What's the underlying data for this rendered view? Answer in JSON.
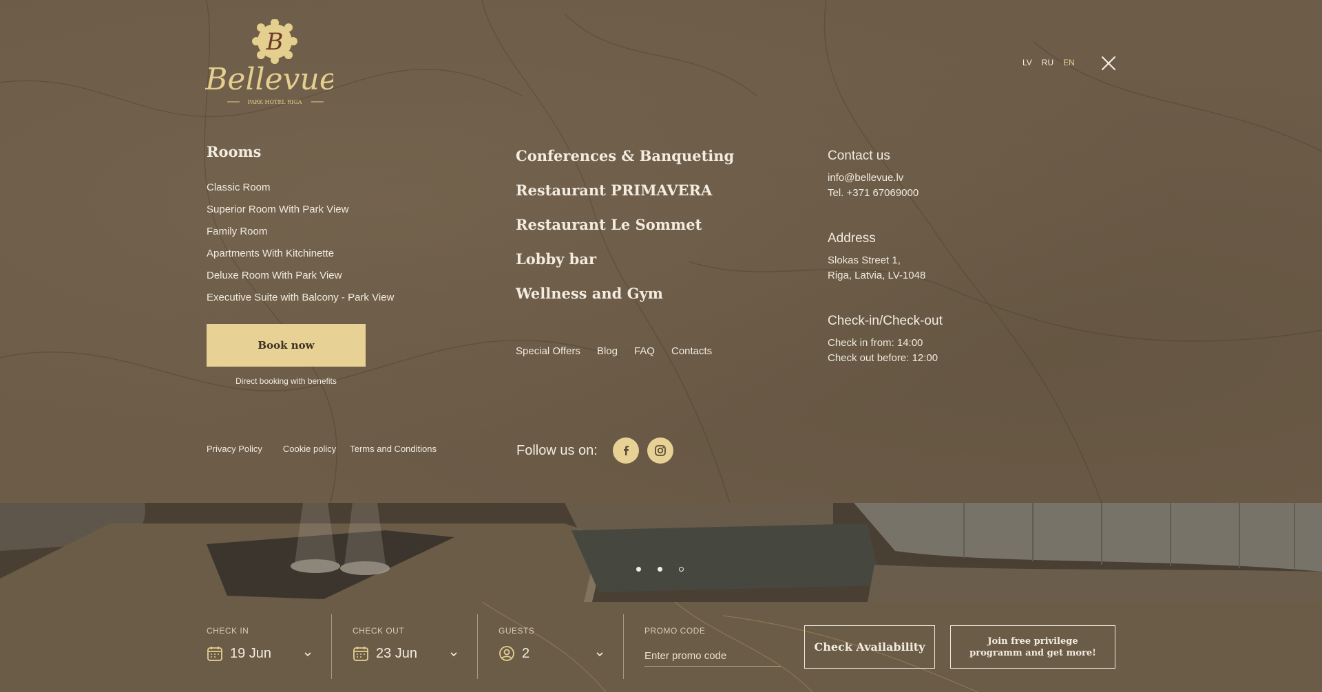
{
  "brand": {
    "monogram": "B",
    "name": "Bellevue",
    "tagline": "PARK HOTEL RIGA"
  },
  "languages": [
    {
      "code": "LV",
      "active": false
    },
    {
      "code": "RU",
      "active": false
    },
    {
      "code": "EN",
      "active": true
    }
  ],
  "rooms": {
    "title": "Rooms",
    "items": [
      "Classic Room",
      "Superior Room With Park View",
      "Family Room",
      "Apartments With Kitchinette",
      "Deluxe Room With Park View",
      "Executive Suite with Balcony - Park View"
    ],
    "book_label": "Book now",
    "book_sub": "Direct booking with benefits"
  },
  "venues": [
    "Conferences & Banqueting",
    "Restaurant PRIMAVERA",
    "Restaurant Le Sommet",
    "Lobby bar",
    "Wellness and Gym"
  ],
  "sublinks": [
    "Special Offers",
    "Blog",
    "FAQ",
    "Contacts"
  ],
  "contact": {
    "title": "Contact us",
    "email": "info@bellevue.lv",
    "phone": "Tel. +371 67069000"
  },
  "address": {
    "title": "Address",
    "line1": "Slokas Street 1,",
    "line2": "Riga, Latvia, LV-1048"
  },
  "checkin": {
    "title": "Check-in/Check-out",
    "line1": "Check in from: 14:00",
    "line2": "Check out before: 12:00"
  },
  "legal": [
    "Privacy Policy",
    "Cookie policy",
    "Terms and Conditions"
  ],
  "follow": {
    "label": "Follow us on:",
    "icons": [
      "facebook-icon",
      "instagram-icon"
    ]
  },
  "slider": {
    "dots": 3,
    "active_index": 2
  },
  "booking": {
    "check_in_label": "CHECK IN",
    "check_in_value": "19 Jun",
    "check_out_label": "CHECK OUT",
    "check_out_value": "23 Jun",
    "guests_label": "GUESTS",
    "guests_value": "2",
    "promo_label": "PROMO CODE",
    "promo_placeholder": "Enter promo code",
    "check_availability": "Check Availability",
    "join_label": "Join free privilege programm and get more!"
  },
  "colors": {
    "background": "#6c5c48",
    "accent": "#e8d195",
    "text": "#f3ece0"
  }
}
